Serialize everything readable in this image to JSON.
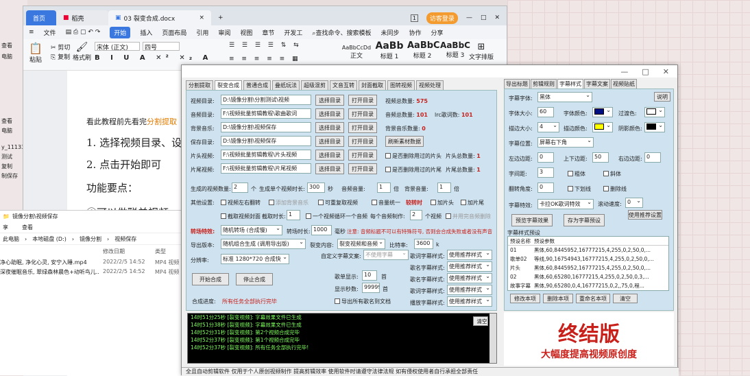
{
  "word": {
    "tab_home": "首页",
    "tab_k": "稻壳",
    "tab_doc": "03 裂变合成.docx",
    "visitor": "访客登录",
    "menu": [
      "文件",
      "开始",
      "插入",
      "页面布局",
      "引用",
      "审阅",
      "视图",
      "章节",
      "开发工"
    ],
    "search": "查找命令、搜索模板",
    "menu_right": [
      "未同步",
      "协作",
      "分享"
    ],
    "font": "宋体 (正文)",
    "size": "四号",
    "paste": "粘贴",
    "cut": "剪切",
    "copy": "复制",
    "format": "格式刷",
    "styles": [
      "AaBbCcDd",
      "AaBb",
      "AaBbC",
      "AaBbC"
    ],
    "style_names": [
      "正文",
      "标题 1",
      "标题 2",
      "标题 3"
    ],
    "text_layout": "文字排版",
    "line0a": "看此教程前先看完",
    "line0b": "分割提取",
    "line1": "1. 选择视频目录、设",
    "line2": "2. 点击开始即可",
    "line3": "功能要点：",
    "line4": "①可以做聪羊视频"
  },
  "explorer": {
    "title": "镜像分割\\视频保存",
    "file": "享",
    "view": "查看",
    "path": [
      "此电脑",
      "本地磁盘 (D:)",
      "镜像分割",
      "视频保存"
    ],
    "cols": [
      "修改日期",
      "类型"
    ],
    "rows": [
      {
        "name": "净心助眠, 净化心灵, 安宁入睡.mp4",
        "date": "2022/2/5 14:52",
        "type": "MP4 视频"
      },
      {
        "name": "深夜催眠音乐, 翠绿森林晨色+动听鸟儿...",
        "date": "2022/2/5 14:52",
        "type": "MP4 视频"
      }
    ]
  },
  "left_strip": [
    "查看",
    "电脑",
    "本地",
    "查看",
    "电脑",
    "y_111330",
    "测试",
    "复制",
    "制保存"
  ],
  "tool": {
    "tabs": [
      "分割提取",
      "裂变合成",
      "普通合成",
      "叠纸玩法",
      "超级混剪",
      "文音互转",
      "封面截取",
      "图转视频",
      "视频处理"
    ],
    "video_dir_label": "视频目录:",
    "video_dir": "D:\\镜像分割\\分割测试\\视频",
    "audio_dir_label": "音频目录:",
    "audio_dir": "F:\\视频批量剪辑教程\\歌曲歌词",
    "bg_dir_label": "背景音乐:",
    "bg_dir": "D:\\镜像分割\\视频保存",
    "save_dir_label": "保存目录:",
    "save_dir": "D:\\镜像分割\\视频保存",
    "head_label": "片头视频:",
    "head_dir": "F:\\视频批量剪辑教程\\片头视频",
    "tail_label": "片尾视频:",
    "tail_dir": "F:\\视频批量剪辑教程\\片尾视频",
    "select": "选择目录",
    "open": "打开目录",
    "refresh": "刷新素材数据",
    "video_total_label": "视频总数量:",
    "video_total": "575",
    "audio_total_label": "音频总数量:",
    "audio_total": "101",
    "lrc_label": "lrc歌词数:",
    "lrc": "101",
    "bg_total_label": "背景音乐数量:",
    "bg_total": "0",
    "del_head": "是否删除用过的片头",
    "head_total_label": "片头总数量:",
    "head_total": "1",
    "del_tail": "是否删除用过的片尾",
    "tail_total_label": "片尾总数量:",
    "tail_total": "1",
    "gen_count_label": "生成的视频数量:",
    "gen_count": "2",
    "unit_ge": "个",
    "gen_len_label": "生成单个视频时长:",
    "gen_len": "300",
    "unit_sec": "秒",
    "vol_label": "音频音量:",
    "vol": "1",
    "bei": "倍",
    "bgvol_label": "背景音量:",
    "bgvol": "1",
    "other_label": "其他设置:",
    "mirror": "视频左右翻转",
    "add_bg": "添加背景音乐",
    "dup": "可重复取视频",
    "unify": "音量统一",
    "fade": "较转时",
    "add_head": "加片头",
    "add_tail": "加片尾",
    "cover": "截取视频封面",
    "clip_len_label": "截取时长:",
    "clip_len": "1",
    "loop": "一个视频循环一个音频",
    "every": "每个音频制作:",
    "every_val": "2",
    "video_unit": "个视频",
    "use_done": "并用完音频删除",
    "trans_label": "转场特效:",
    "trans": "随机转场 (合成慢)",
    "trans_len_label": "转场时长:",
    "trans_len": "1000",
    "ms": "毫秒",
    "note": "注意: 音频标题不可以有特殊符号, 否则会合成失败或者没有声音",
    "export_label": "导出版本:",
    "export": "随机组合生成 (调用导出版)",
    "split_label": "裂变内容:",
    "split": "裂变视频和音频",
    "rate_label": "比特率:",
    "rate": "3600",
    "k": "k",
    "res_label": "分辨率:",
    "res": "标准 1280*720 合成快",
    "custom_label": "自定义字幕文案:",
    "custom": "不使用字幕",
    "sub_labels": [
      "歌词字幕样式:",
      "歌名字幕样式:",
      "歌名字幕样式:",
      "歌词字幕样式:",
      "播放字幕样式:"
    ],
    "sub_val": "使用推荐样式",
    "num_show_label": "歌单显示:",
    "num_show": "10",
    "num_unit": "首",
    "show_sec_label": "显示秒数:",
    "show_sec": "99999",
    "export_txt": "导出所有歌名到文档",
    "start": "开始合成",
    "stop": "停止合成",
    "status_label": "合成进度:",
    "status": "所有任务全部执行完毕",
    "logs": [
      "14时51分25秒 [裂变视频]: 字幕效果文件已生成",
      "14时51分38秒 [裂变视频]: 字幕效果文件已生成",
      "14时52分31秒 [裂变视频]: 第2个视频合成完毕",
      "14时52分37秒 [裂变视频]: 第1个视频合成完毕",
      "14时52分37秒 [裂变视频]: 所有任务全部执行完毕!"
    ],
    "clear": "清空",
    "bottom": "全且自动剪辑软件  仅用于个人原创视频制作  提高剪辑效率  使用软件时请遵守法律法规  如有侵权使用者自行承担全部责任"
  },
  "right": {
    "tabs": [
      "导出标题",
      "剪辑规则",
      "字幕样式",
      "字幕文案",
      "视频贴纸"
    ],
    "font_label": "字幕字体:",
    "font": "黑体",
    "explain": "说明",
    "size_label": "字体大小:",
    "size": "60",
    "color_label": "字体颜色:",
    "color": "#001080",
    "transition_label": "过渡色:",
    "stroke_label": "描边大小:",
    "stroke": "4",
    "stroke_color_label": "描边颜色:",
    "stroke_color": "#ffff00",
    "shadow_label": "阴影颜色:",
    "shadow_color": "#000000",
    "pos_label": "字幕位置:",
    "pos": "屏幕右下角",
    "lm_label": "左边边距:",
    "lm": "0",
    "tb_label": "上下边距:",
    "tb": "50",
    "rm_label": "右边边距:",
    "rm": "0",
    "space_label": "字间距:",
    "space": "3",
    "bold": "粗体",
    "italic": "斜体",
    "angle_label": "翻转角度:",
    "angle": "0",
    "underline": "下划线",
    "strike": "删除线",
    "effect_label": "字幕特效:",
    "effect": "卡拉OK歌词特效",
    "speed_label": "滚动速度:",
    "speed": "0",
    "use_rec": "使用推荐设置",
    "preview": "预览字幕效果",
    "save_preset": "存为字幕预设",
    "preset_title": "字幕样式预设",
    "list_cols": [
      "预设名称",
      "预设参数"
    ],
    "list": [
      [
        "01",
        "黑体,60,8445952,16777215,4,255,0,2,50,0,..."
      ],
      [
        "歌单02",
        "等线,90,16754943,16777215,4,255,0,2,50,0,..."
      ],
      [
        "片头",
        "黑体,60,8445952,16777215,4,255,0,2,50,0,..."
      ],
      [
        "02",
        "黑体,60,65280,16777215,4,255,0,2,50,0,3,..."
      ],
      [
        "故事字幕",
        "黑体,90,65280,0,4,16777215,0,2,,75,0,程..."
      ]
    ],
    "modify": "修改本项",
    "del": "删除本项",
    "rename": "重命名本项",
    "clear": "清空"
  },
  "banner": {
    "title": "终结版",
    "sub": "大幅度提高视频原创度"
  }
}
